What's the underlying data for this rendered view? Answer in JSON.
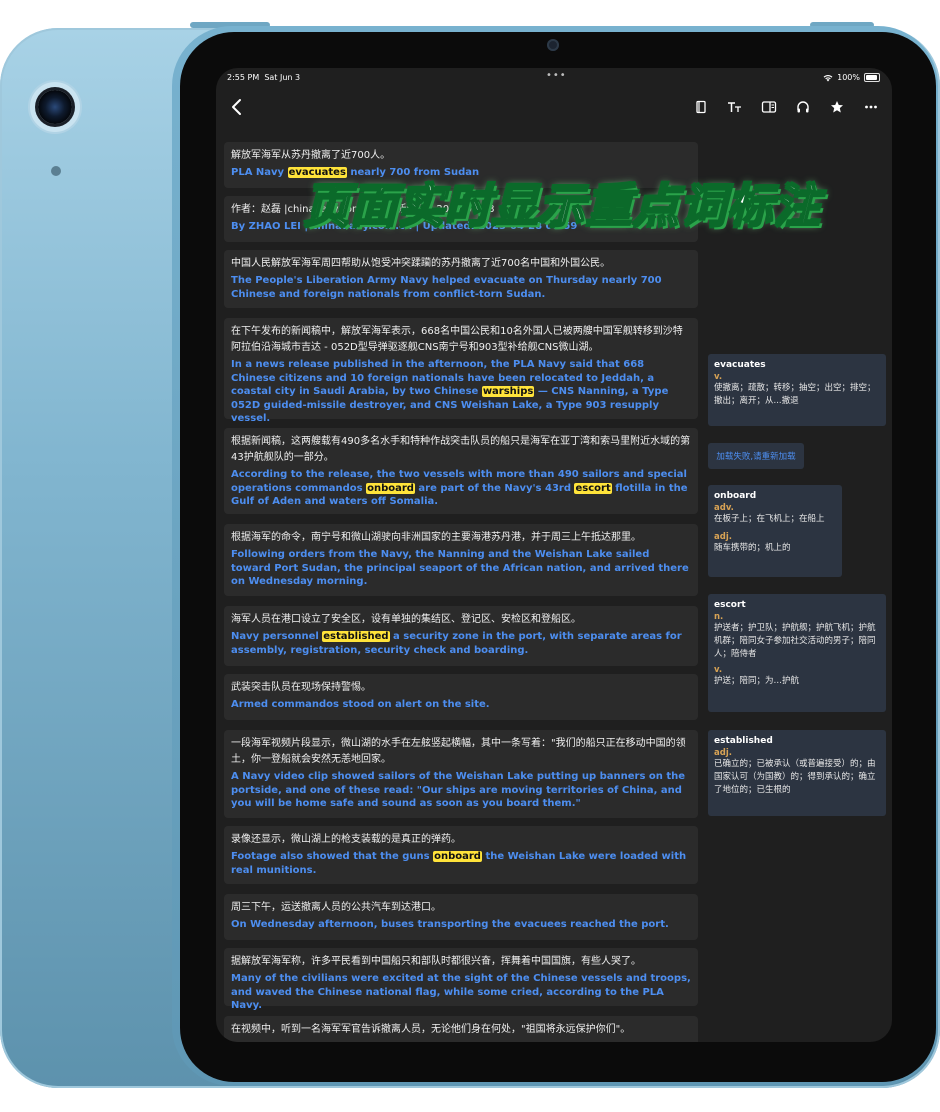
{
  "status_bar": {
    "time": "2:55 PM",
    "date": "Sat Jun 3",
    "dots": "•••",
    "battery": "100%",
    "wifi_icon": "wifi-icon"
  },
  "toolbar": {
    "icons": [
      "back-chevron-icon",
      "bookmark-icon",
      "text-size-icon",
      "reader-layout-icon",
      "headphones-icon",
      "star-icon",
      "more-icon"
    ]
  },
  "paragraphs": [
    {
      "zh": "解放军海军从苏丹撤离了近700人。",
      "en": [
        "PLA Navy ",
        "evacuates",
        " nearly 700 from Sudan"
      ]
    },
    {
      "zh": "作者：赵磊 |chinadaily.com.cn | 更新时间：2023-04-28",
      "en": [
        "By ZHAO LEI | chinadaily.com.cn | Updated: 2023-04-28 08:59"
      ]
    },
    {
      "zh": "中国人民解放军海军周四帮助从饱受冲突蹂躏的苏丹撤离了近700名中国和外国公民。",
      "en": [
        "The People's Liberation Army Navy helped evacuate on Thursday nearly 700 Chinese and foreign nationals from conflict-torn Sudan."
      ]
    },
    {
      "zh": "在下午发布的新闻稿中，解放军海军表示，668名中国公民和10名外国人已被两艘中国军舰转移到沙特阿拉伯沿海城市吉达 - 052D型导弹驱逐舰CNS南宁号和903型补给舰CNS微山湖。",
      "en": [
        "In a news release published in the afternoon, the PLA Navy said that 668 Chinese citizens and 10 foreign nationals have been relocated to Jeddah, a coastal city in Saudi Arabia, by two Chinese ",
        "warships",
        " — CNS Nanning, a Type 052D guided-missile destroyer, and CNS Weishan Lake, a Type 903 resupply vessel."
      ]
    },
    {
      "zh": "根据新闻稿，这两艘载有490多名水手和特种作战突击队员的船只是海军在亚丁湾和索马里附近水域的第43护航舰队的一部分。",
      "en": [
        "According to the release, the two vessels with more than 490 sailors and special operations commandos ",
        "onboard",
        " are part of the Navy's 43rd ",
        "escort",
        " flotilla in the Gulf of Aden and waters off Somalia."
      ]
    },
    {
      "zh": "根据海军的命令，南宁号和微山湖驶向非洲国家的主要海港苏丹港，并于周三上午抵达那里。",
      "en": [
        "Following orders from the Navy, the Nanning and the Weishan Lake sailed toward Port Sudan, the principal seaport of the African nation, and arrived there on Wednesday morning."
      ]
    },
    {
      "zh": "海军人员在港口设立了安全区，设有单独的集结区、登记区、安检区和登船区。",
      "en": [
        "Navy personnel ",
        "established",
        " a security zone in the port, with separate areas for assembly, registration, security check and boarding."
      ]
    },
    {
      "zh": "武装突击队员在现场保持警惕。",
      "en": [
        "Armed commandos stood on alert on the site."
      ]
    },
    {
      "zh": "一段海军视频片段显示，微山湖的水手在左舷竖起横幅，其中一条写着：\"我们的船只正在移动中国的领土，你一登船就会安然无恙地回家。",
      "en": [
        "A Navy video clip showed sailors of the Weishan Lake putting up banners on the portside, and one of these read: \"Our ships are moving territories of China, and you will be home safe and sound as soon as you board them.\""
      ]
    },
    {
      "zh": "录像还显示，微山湖上的枪支装载的是真正的弹药。",
      "en": [
        "Footage also showed that the guns ",
        "onboard",
        " the Weishan Lake were loaded with real munitions."
      ]
    },
    {
      "zh": "周三下午，运送撤离人员的公共汽车到达港口。",
      "en": [
        "On Wednesday afternoon, buses transporting the evacuees reached the port."
      ]
    },
    {
      "zh": "据解放军海军称，许多平民看到中国船只和部队时都很兴奋，挥舞着中国国旗，有些人哭了。",
      "en": [
        "Many of the civilians were excited at the sight of the Chinese vessels and troops, and waved the Chinese national flag, while some cried, according to the PLA Navy."
      ]
    },
    {
      "zh": "在视频中，听到一名海军军官告诉撤离人员，无论他们身在何处，\"祖国将永远保护你们\"。",
      "en": [
        ""
      ]
    }
  ],
  "sidebar": {
    "reload_label": "加载失败,请重新加载",
    "cards": [
      {
        "word": "evacuates",
        "entries": [
          {
            "pos": "v.",
            "def": "使撤离；疏散；转移；抽空；出空；排空；撤出；离开；从...撤退"
          }
        ]
      },
      {
        "word": "onboard",
        "entries": [
          {
            "pos": "adv.",
            "def": "在板子上；在飞机上；在船上"
          },
          {
            "pos": "adj.",
            "def": "随车携带的；机上的"
          }
        ]
      },
      {
        "word": "escort",
        "entries": [
          {
            "pos": "n.",
            "def": "护送者；护卫队；护航舰；护航飞机；护航机群；陪同女子参加社交活动的男子；陪同人；陪侍者"
          },
          {
            "pos": "v.",
            "def": "护送；陪同；为…护航"
          }
        ]
      },
      {
        "word": "established",
        "entries": [
          {
            "pos": "adj.",
            "def": "已确立的；已被承认（或普遍接受）的；由国家认可（为国教）的；得到承认的；确立了地位的；已生根的"
          }
        ]
      }
    ]
  },
  "overlay": {
    "title": "页面实时显示重点词标注"
  }
}
